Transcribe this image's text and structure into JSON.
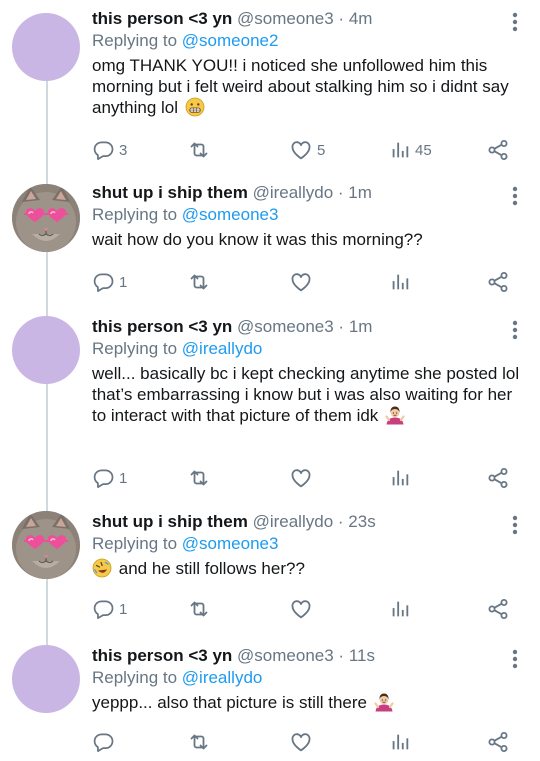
{
  "tweets": [
    {
      "display_name": "this person <3 yn",
      "handle": "@someone3",
      "dot": "·",
      "time": "4m",
      "replying_prefix": "Replying to ",
      "replying_to": "@someone2",
      "text": "omg THANK YOU!! i noticed she unfollowed him this morning but i felt weird about stalking him so i didnt say anything lol",
      "trailing_emoji": "grimacing-face",
      "reply_count": "3",
      "retweet_count": "",
      "like_count": "5",
      "view_count": "45",
      "avatar": "plain-lavender"
    },
    {
      "display_name": "shut up i ship them",
      "handle": "@ireallydo",
      "dot": "·",
      "time": "1m",
      "replying_prefix": "Replying to ",
      "replying_to": "@someone3",
      "text": "wait how do you know it was this morning??",
      "reply_count": "1",
      "retweet_count": "",
      "like_count": "",
      "view_count": "",
      "avatar": "cat-with-heart-sunglasses"
    },
    {
      "display_name": "this person <3 yn",
      "handle": "@someone3",
      "dot": "·",
      "time": "1m",
      "replying_prefix": "Replying to ",
      "replying_to": "@ireallydo",
      "text": "well... basically bc i kept checking anytime she posted lol that’s embarrassing i know but i was also waiting for her to interact with that picture of them idk",
      "trailing_emoji": "person-shrugging",
      "reply_count": "1",
      "retweet_count": "",
      "like_count": "",
      "view_count": "",
      "avatar": "plain-lavender"
    },
    {
      "display_name": "shut up i ship them",
      "handle": "@ireallydo",
      "dot": "·",
      "time": "23s",
      "replying_prefix": "Replying to ",
      "replying_to": "@someone3",
      "leading_emoji": "rolling-on-floor-laughing",
      "text": "and he still follows her??",
      "reply_count": "1",
      "retweet_count": "",
      "like_count": "",
      "view_count": "",
      "avatar": "cat-with-heart-sunglasses"
    },
    {
      "display_name": "this person <3 yn",
      "handle": "@someone3",
      "dot": "·",
      "time": "11s",
      "replying_prefix": "Replying to ",
      "replying_to": "@ireallydo",
      "text": "yeppp... also that picture is still there",
      "trailing_emoji": "person-shrugging",
      "reply_count": "",
      "retweet_count": "",
      "like_count": "",
      "view_count": "",
      "avatar": "plain-lavender"
    }
  ],
  "colors": {
    "text": "#14171a",
    "secondary": "#687684",
    "mention": "#1d9bf0",
    "avatar_lavender": "#c9b6e4",
    "thread_line": "#cfd9de"
  },
  "icons": [
    "more-icon",
    "reply-icon",
    "retweet-icon",
    "like-icon",
    "views-icon",
    "share-icon"
  ]
}
